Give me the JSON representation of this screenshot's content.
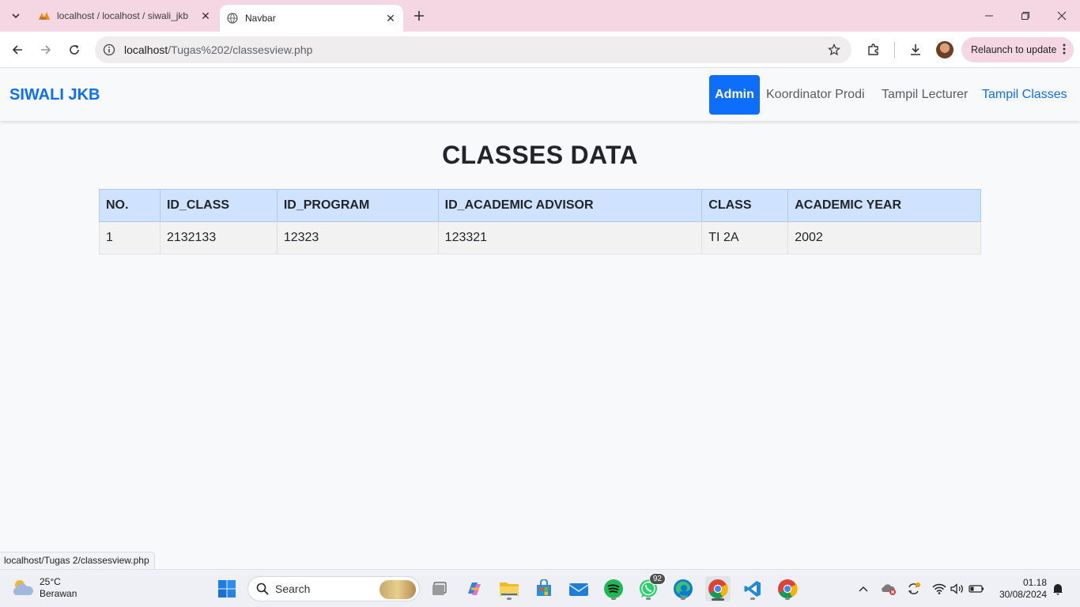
{
  "browser": {
    "tabs": [
      {
        "title": "localhost / localhost / siwali_jkb",
        "active": false
      },
      {
        "title": "Navbar",
        "active": true
      }
    ],
    "url_host": "localhost",
    "url_path": "/Tugas%202/classesview.php",
    "relaunch_label": "Relaunch to update",
    "status_url": "localhost/Tugas 2/classesview.php"
  },
  "navbar": {
    "brand": "SIWALI JKB",
    "links": {
      "admin": "Admin",
      "koordinator": "Koordinator Prodi",
      "lecturer": "Tampil Lecturer",
      "classes": "Tampil Classes"
    }
  },
  "main": {
    "title": "CLASSES DATA",
    "table": {
      "headers": [
        "NO.",
        "ID_CLASS",
        "ID_PROGRAM",
        "ID_ACADEMIC ADVISOR",
        "CLASS",
        "ACADEMIC YEAR"
      ],
      "rows": [
        [
          "1",
          "2132133",
          "12323",
          "123321",
          "TI 2A",
          "2002"
        ]
      ]
    }
  },
  "taskbar": {
    "weather_temp": "25°C",
    "weather_cond": "Berawan",
    "search_label": "Search",
    "whatsapp_badge": "92",
    "time": "01.18",
    "date": "30/08/2024"
  }
}
